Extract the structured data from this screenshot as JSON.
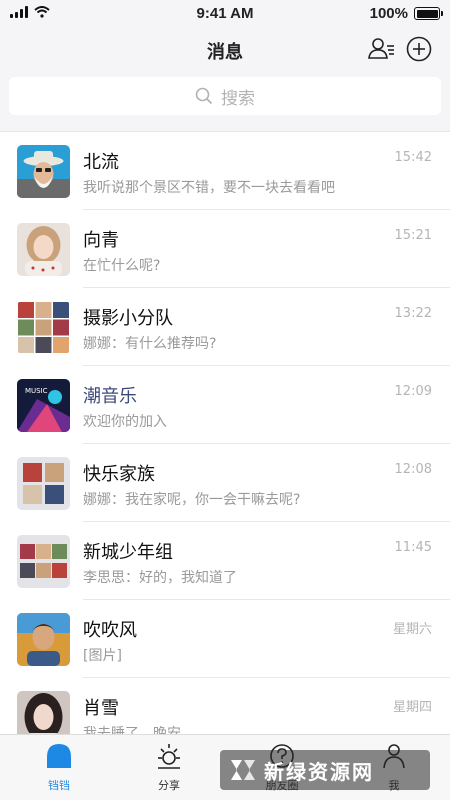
{
  "status_bar": {
    "time": "9:41 AM",
    "battery": "100%"
  },
  "header": {
    "title": "消息",
    "contacts_icon": "contacts-icon",
    "add_icon": "add-circle-icon"
  },
  "search": {
    "placeholder": "搜索",
    "icon": "search-icon"
  },
  "conversations": [
    {
      "name": "北流",
      "preview": "我听说那个景区不错，要不一块去看看吧",
      "time": "15:42",
      "avatar": "man-hat-photo"
    },
    {
      "name": "向青",
      "preview": "在忙什么呢?",
      "time": "15:21",
      "avatar": "girl-photo"
    },
    {
      "name": "摄影小分队",
      "preview": "娜娜：有什么推荐吗?",
      "time": "13:22",
      "avatar": "group-collage-photo"
    },
    {
      "name": "潮音乐",
      "preview": "欢迎你的加入",
      "time": "12:09",
      "avatar": "music-poster"
    },
    {
      "name": "快乐家族",
      "preview": "娜娜：我在家呢，你一会干嘛去呢?",
      "time": "12:08",
      "avatar": "group-collage-photo"
    },
    {
      "name": "新城少年组",
      "preview": "李思思：好的，我知道了",
      "time": "11:45",
      "avatar": "group-collage-photo"
    },
    {
      "name": "吹吹风",
      "preview": "[图片]",
      "time": "星期六",
      "avatar": "man-photo"
    },
    {
      "name": "肖雪",
      "preview": "我去睡了，晚安",
      "time": "星期四",
      "avatar": "woman-photo"
    }
  ],
  "tabs": [
    {
      "label": "铛铛",
      "icon": "bell-icon",
      "active": true
    },
    {
      "label": "分享",
      "icon": "sun-icon",
      "active": false
    },
    {
      "label": "朋友圈",
      "icon": "compass-icon",
      "active": false
    },
    {
      "label": "我",
      "icon": "person-icon",
      "active": false
    }
  ],
  "watermark": {
    "text": "新绿资源网",
    "url": "www.xlhs.com"
  },
  "colors": {
    "accent": "#1e88e5",
    "background": "#f5f5f7",
    "name_highlight": "#3c4a7a"
  }
}
